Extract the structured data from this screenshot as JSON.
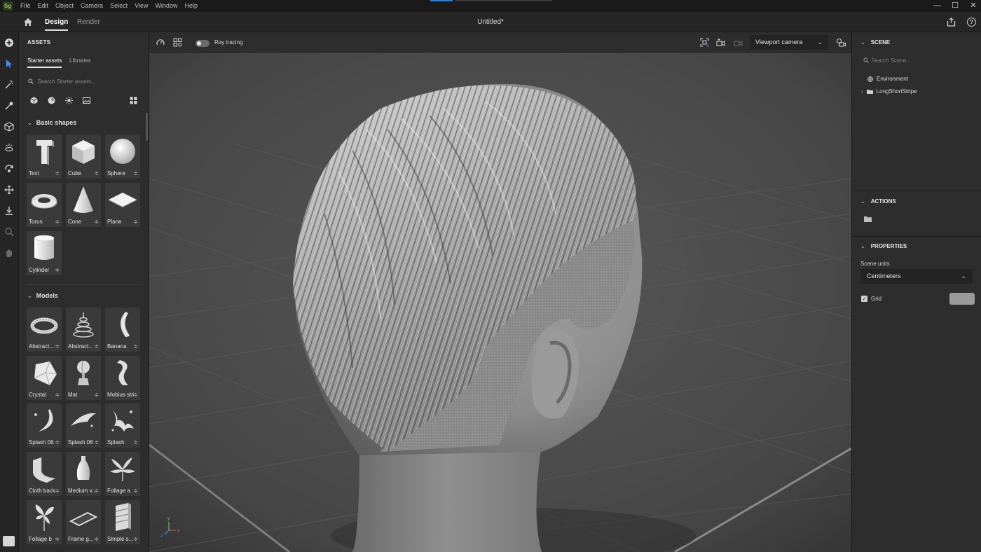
{
  "menubar": {
    "logo": "Sg",
    "items": [
      "File",
      "Edit",
      "Object",
      "Camera",
      "Select",
      "View",
      "Window",
      "Help"
    ],
    "window_controls": [
      "—",
      "☐",
      "✕"
    ]
  },
  "header": {
    "tabs": [
      {
        "label": "Design",
        "active": true
      },
      {
        "label": "Render",
        "active": false
      }
    ],
    "document_title": "Untitled*"
  },
  "tool_rail": {
    "tools": [
      "add-icon",
      "select-icon",
      "magic-wand-icon",
      "eyedropper-icon",
      "cube-icon",
      "light-icon",
      "orbit-icon",
      "move-icon",
      "drop-to-ground-icon",
      "zoom-icon",
      "pan-hand-icon"
    ]
  },
  "assets": {
    "title": "ASSETS",
    "tabs": [
      "Starter assets",
      "Libraries"
    ],
    "search_placeholder": "Search Starter assets...",
    "filters": [
      "model-filter-icon",
      "material-filter-icon",
      "light-filter-icon",
      "image-filter-icon",
      "grid-view-icon"
    ],
    "sections": [
      {
        "title": "Basic shapes",
        "items": [
          "Text",
          "Cube",
          "Sphere",
          "Torus",
          "Cone",
          "Plane",
          "Cylinder"
        ]
      },
      {
        "title": "Models",
        "items": [
          "Abstract...",
          "Abstract...",
          "Banana",
          "Crystal",
          "Mat",
          "Mobius strip",
          "Splash 06",
          "Splash 08",
          "Splash",
          "Cloth back...",
          "Medium v...",
          "Foliage a",
          "Foliage b",
          "Frame g...",
          "Simple s..."
        ]
      }
    ]
  },
  "viewport": {
    "toolbar": {
      "ray_tracing_label": "Ray tracing",
      "ray_tracing_on": false,
      "camera": "Viewport camera"
    },
    "axis_labels": [
      "y",
      "x",
      "z"
    ]
  },
  "right_panel": {
    "scene": {
      "title": "SCENE",
      "search_placeholder": "Search Scene...",
      "items": [
        "Environment",
        "LongShortStripe"
      ]
    },
    "actions": {
      "title": "ACTIONS"
    },
    "properties": {
      "title": "PROPERTIES",
      "scene_units_label": "Scene units",
      "scene_units_value": "Centimeters",
      "grid_label": "Grid",
      "grid_checked": true,
      "grid_color": "#9a9a9a"
    }
  }
}
